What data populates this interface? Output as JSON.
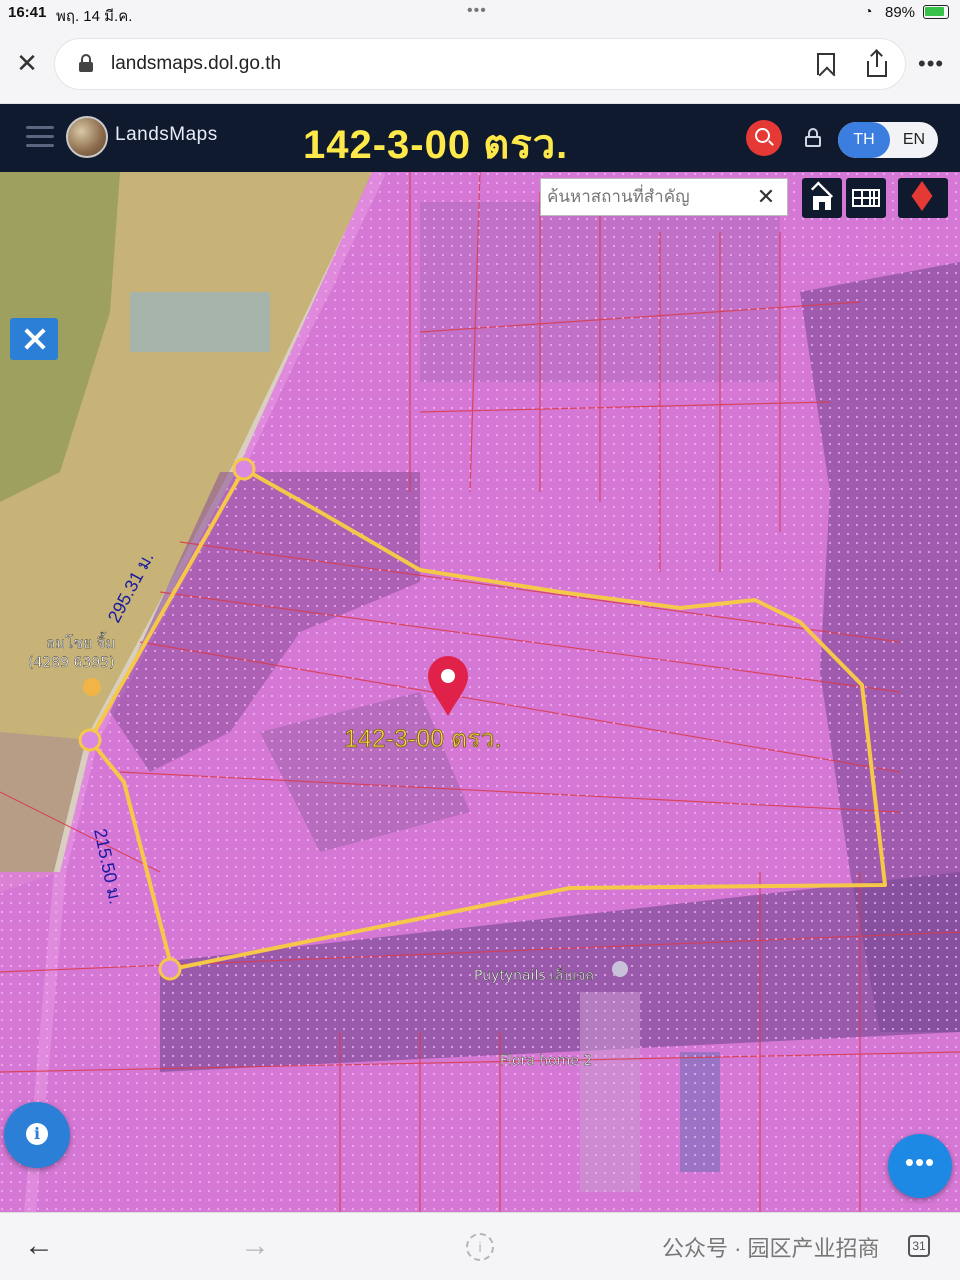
{
  "status_bar": {
    "time": "16:41",
    "date": "พฤ. 14 มี.ค.",
    "battery": "89%"
  },
  "browser": {
    "url": "landsmaps.dol.go.th"
  },
  "header": {
    "app_name": "LandsMaps",
    "title": "142-3-00 ตรว.",
    "lang_th": "TH",
    "lang_en": "EN"
  },
  "map": {
    "search_placeholder": "ค้นหาสถานที่สำคัญ",
    "area_label": "142-3-00 ตรว.",
    "side_length_1": "295.31 ม.",
    "side_length_2": "215.50 ม.",
    "place_labels": [
      "ลมโชย จิ้ม",
      "(4289 6395)",
      "Puytynails เล็บเจล",
      "Flora home 2"
    ],
    "colors": {
      "overlay": "#e070e0",
      "boundary": "#f5c84a",
      "marker": "#e0224a"
    }
  },
  "bottom_bar": {
    "watermark": "公众号 · 园区产业招商"
  }
}
